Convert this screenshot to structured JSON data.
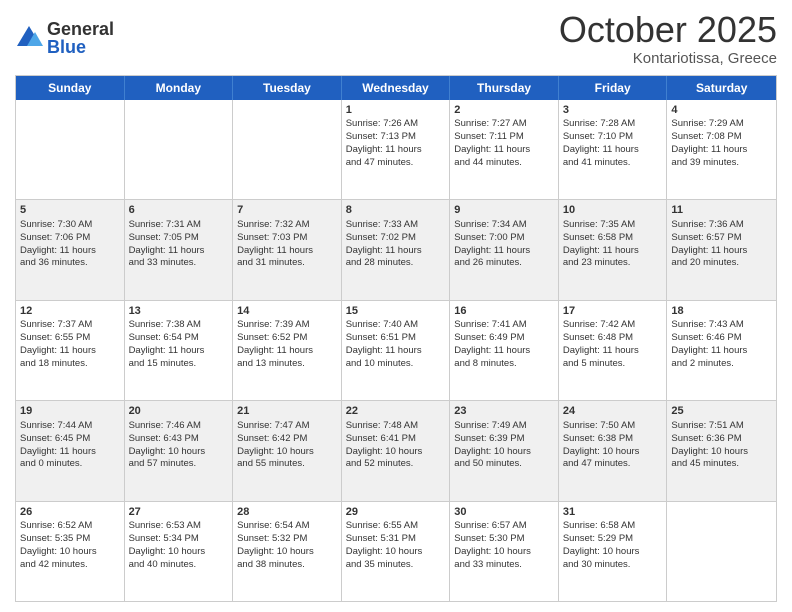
{
  "logo": {
    "general": "General",
    "blue": "Blue"
  },
  "header": {
    "month": "October 2025",
    "location": "Kontariotissa, Greece"
  },
  "days": [
    "Sunday",
    "Monday",
    "Tuesday",
    "Wednesday",
    "Thursday",
    "Friday",
    "Saturday"
  ],
  "rows": [
    [
      {
        "day": "",
        "info": ""
      },
      {
        "day": "",
        "info": ""
      },
      {
        "day": "",
        "info": ""
      },
      {
        "day": "1",
        "info": "Sunrise: 7:26 AM\nSunset: 7:13 PM\nDaylight: 11 hours\nand 47 minutes."
      },
      {
        "day": "2",
        "info": "Sunrise: 7:27 AM\nSunset: 7:11 PM\nDaylight: 11 hours\nand 44 minutes."
      },
      {
        "day": "3",
        "info": "Sunrise: 7:28 AM\nSunset: 7:10 PM\nDaylight: 11 hours\nand 41 minutes."
      },
      {
        "day": "4",
        "info": "Sunrise: 7:29 AM\nSunset: 7:08 PM\nDaylight: 11 hours\nand 39 minutes."
      }
    ],
    [
      {
        "day": "5",
        "info": "Sunrise: 7:30 AM\nSunset: 7:06 PM\nDaylight: 11 hours\nand 36 minutes."
      },
      {
        "day": "6",
        "info": "Sunrise: 7:31 AM\nSunset: 7:05 PM\nDaylight: 11 hours\nand 33 minutes."
      },
      {
        "day": "7",
        "info": "Sunrise: 7:32 AM\nSunset: 7:03 PM\nDaylight: 11 hours\nand 31 minutes."
      },
      {
        "day": "8",
        "info": "Sunrise: 7:33 AM\nSunset: 7:02 PM\nDaylight: 11 hours\nand 28 minutes."
      },
      {
        "day": "9",
        "info": "Sunrise: 7:34 AM\nSunset: 7:00 PM\nDaylight: 11 hours\nand 26 minutes."
      },
      {
        "day": "10",
        "info": "Sunrise: 7:35 AM\nSunset: 6:58 PM\nDaylight: 11 hours\nand 23 minutes."
      },
      {
        "day": "11",
        "info": "Sunrise: 7:36 AM\nSunset: 6:57 PM\nDaylight: 11 hours\nand 20 minutes."
      }
    ],
    [
      {
        "day": "12",
        "info": "Sunrise: 7:37 AM\nSunset: 6:55 PM\nDaylight: 11 hours\nand 18 minutes."
      },
      {
        "day": "13",
        "info": "Sunrise: 7:38 AM\nSunset: 6:54 PM\nDaylight: 11 hours\nand 15 minutes."
      },
      {
        "day": "14",
        "info": "Sunrise: 7:39 AM\nSunset: 6:52 PM\nDaylight: 11 hours\nand 13 minutes."
      },
      {
        "day": "15",
        "info": "Sunrise: 7:40 AM\nSunset: 6:51 PM\nDaylight: 11 hours\nand 10 minutes."
      },
      {
        "day": "16",
        "info": "Sunrise: 7:41 AM\nSunset: 6:49 PM\nDaylight: 11 hours\nand 8 minutes."
      },
      {
        "day": "17",
        "info": "Sunrise: 7:42 AM\nSunset: 6:48 PM\nDaylight: 11 hours\nand 5 minutes."
      },
      {
        "day": "18",
        "info": "Sunrise: 7:43 AM\nSunset: 6:46 PM\nDaylight: 11 hours\nand 2 minutes."
      }
    ],
    [
      {
        "day": "19",
        "info": "Sunrise: 7:44 AM\nSunset: 6:45 PM\nDaylight: 11 hours\nand 0 minutes."
      },
      {
        "day": "20",
        "info": "Sunrise: 7:46 AM\nSunset: 6:43 PM\nDaylight: 10 hours\nand 57 minutes."
      },
      {
        "day": "21",
        "info": "Sunrise: 7:47 AM\nSunset: 6:42 PM\nDaylight: 10 hours\nand 55 minutes."
      },
      {
        "day": "22",
        "info": "Sunrise: 7:48 AM\nSunset: 6:41 PM\nDaylight: 10 hours\nand 52 minutes."
      },
      {
        "day": "23",
        "info": "Sunrise: 7:49 AM\nSunset: 6:39 PM\nDaylight: 10 hours\nand 50 minutes."
      },
      {
        "day": "24",
        "info": "Sunrise: 7:50 AM\nSunset: 6:38 PM\nDaylight: 10 hours\nand 47 minutes."
      },
      {
        "day": "25",
        "info": "Sunrise: 7:51 AM\nSunset: 6:36 PM\nDaylight: 10 hours\nand 45 minutes."
      }
    ],
    [
      {
        "day": "26",
        "info": "Sunrise: 6:52 AM\nSunset: 5:35 PM\nDaylight: 10 hours\nand 42 minutes."
      },
      {
        "day": "27",
        "info": "Sunrise: 6:53 AM\nSunset: 5:34 PM\nDaylight: 10 hours\nand 40 minutes."
      },
      {
        "day": "28",
        "info": "Sunrise: 6:54 AM\nSunset: 5:32 PM\nDaylight: 10 hours\nand 38 minutes."
      },
      {
        "day": "29",
        "info": "Sunrise: 6:55 AM\nSunset: 5:31 PM\nDaylight: 10 hours\nand 35 minutes."
      },
      {
        "day": "30",
        "info": "Sunrise: 6:57 AM\nSunset: 5:30 PM\nDaylight: 10 hours\nand 33 minutes."
      },
      {
        "day": "31",
        "info": "Sunrise: 6:58 AM\nSunset: 5:29 PM\nDaylight: 10 hours\nand 30 minutes."
      },
      {
        "day": "",
        "info": ""
      }
    ]
  ]
}
